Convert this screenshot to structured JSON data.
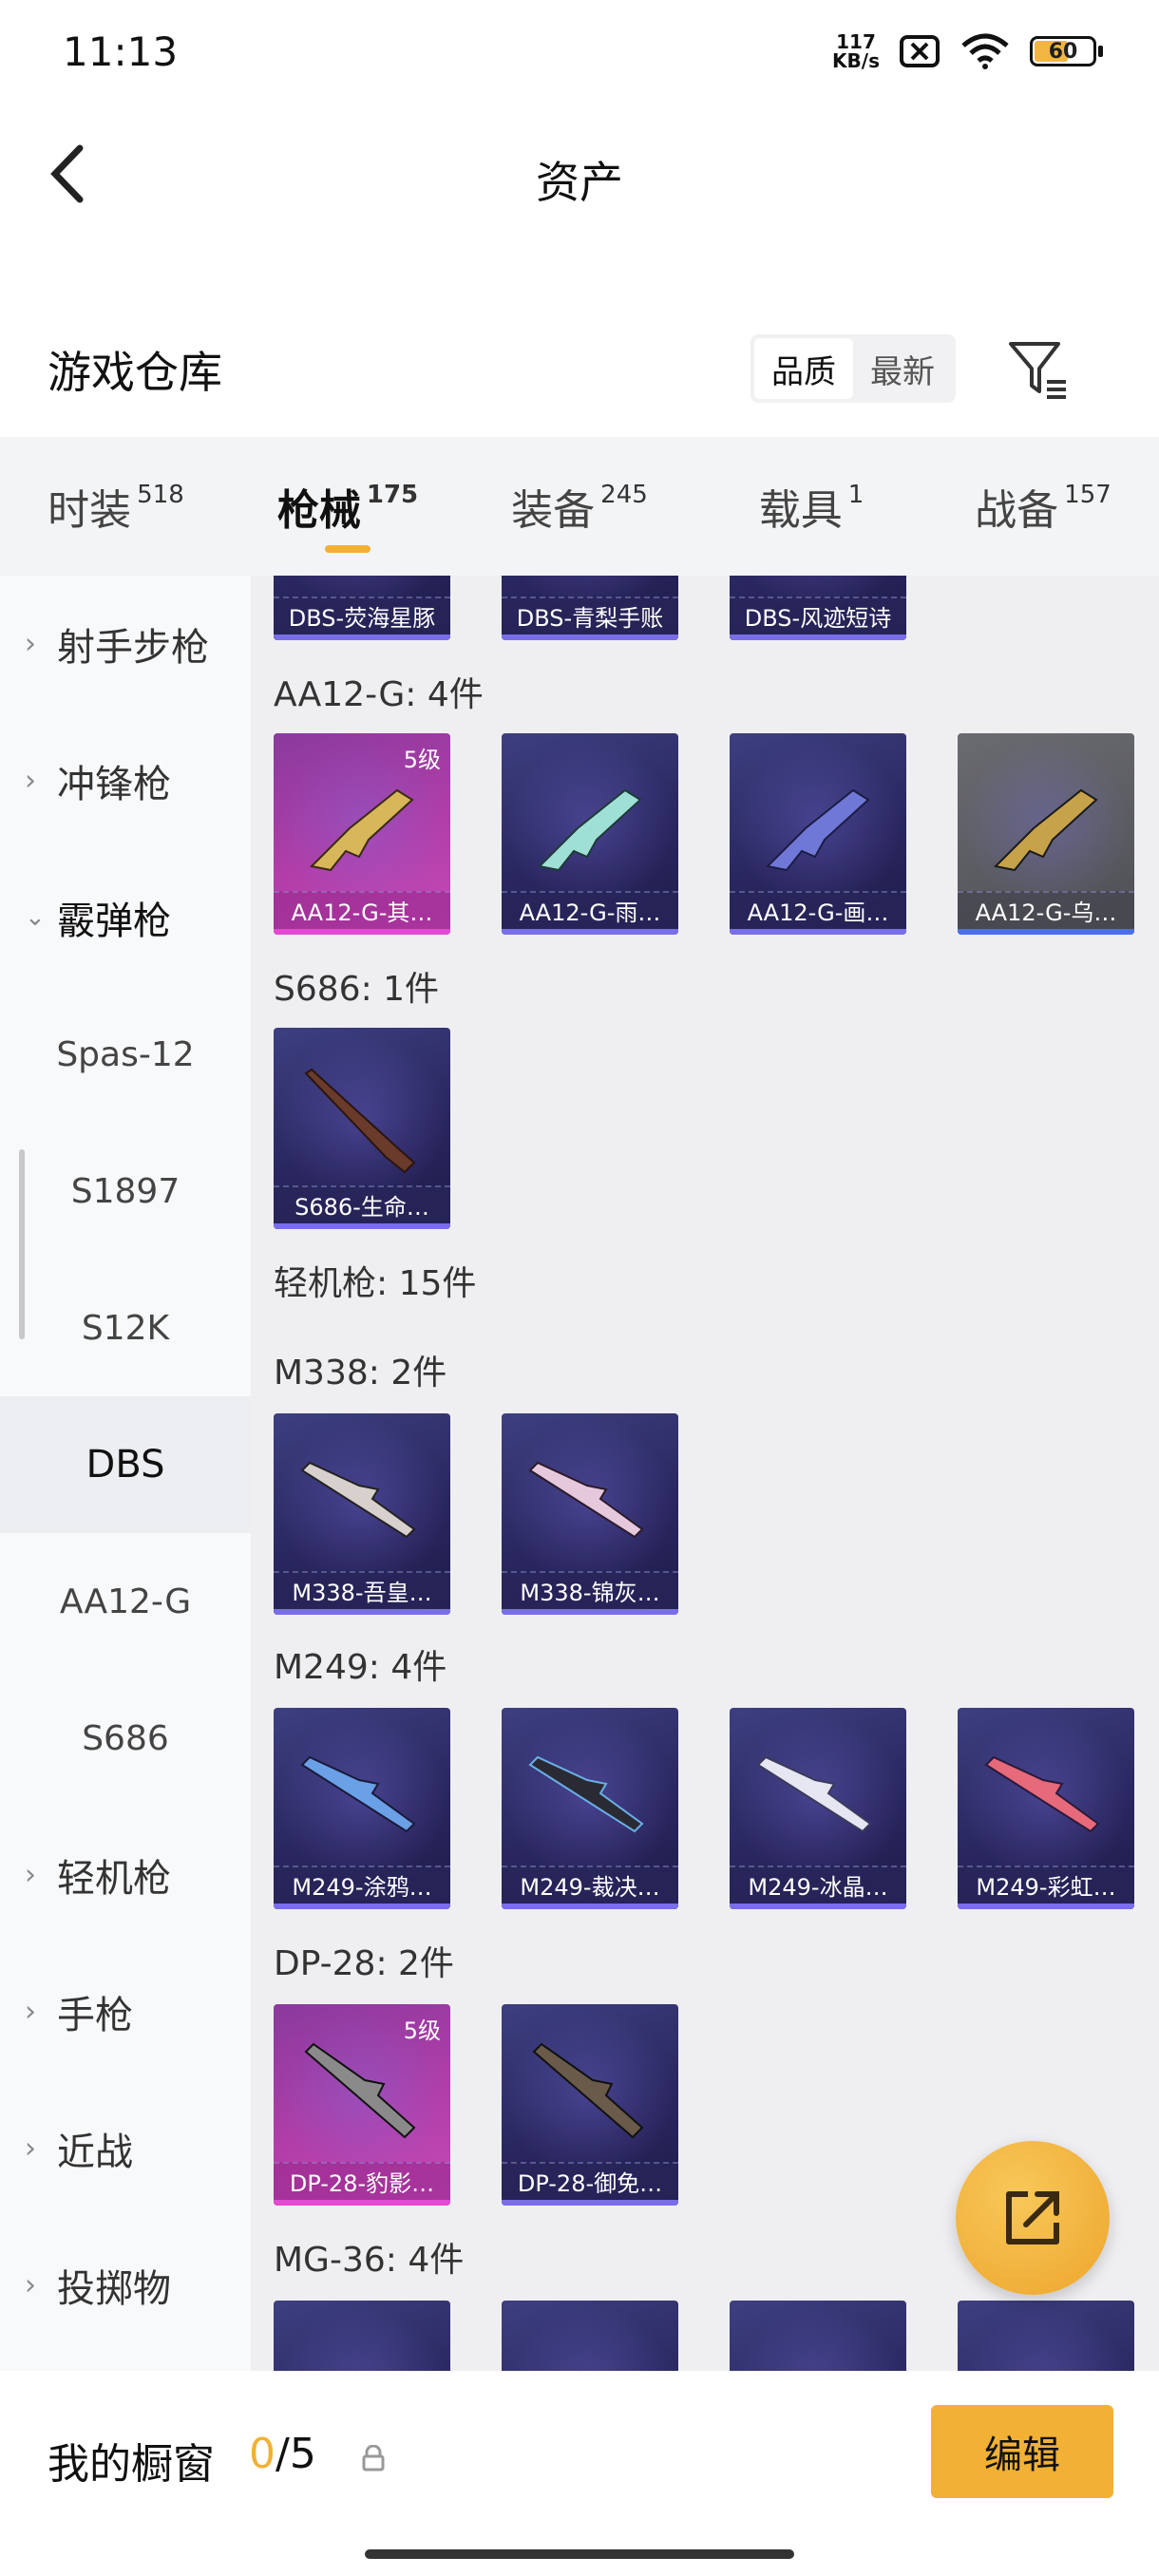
{
  "status": {
    "time": "11:13",
    "speed_value": "117",
    "speed_unit": "KB/s",
    "battery": "60"
  },
  "header": {
    "title": "资产"
  },
  "warehouse": {
    "title": "游戏仓库",
    "sort_quality": "品质",
    "sort_newest": "最新"
  },
  "tabs": [
    {
      "label": "时装",
      "count": "518"
    },
    {
      "label": "枪械",
      "count": "175"
    },
    {
      "label": "装备",
      "count": "245"
    },
    {
      "label": "载具",
      "count": "1"
    },
    {
      "label": "战备",
      "count": "157"
    }
  ],
  "sidebar": {
    "items": [
      {
        "label": "射手步枪"
      },
      {
        "label": "冲锋枪"
      },
      {
        "label": "霰弹枪"
      },
      {
        "label": "Spas-12"
      },
      {
        "label": "S1897"
      },
      {
        "label": "S12K"
      },
      {
        "label": "DBS"
      },
      {
        "label": "AA12-G"
      },
      {
        "label": "S686"
      },
      {
        "label": "轻机枪"
      },
      {
        "label": "手枪"
      },
      {
        "label": "近战"
      },
      {
        "label": "投掷物"
      }
    ]
  },
  "content": {
    "top_cards": [
      "DBS-荧海星豚",
      "DBS-青梨手账",
      "DBS-风迹短诗"
    ],
    "groups": [
      {
        "title": "AA12-G: 4件",
        "items": [
          "AA12-G-其…",
          "AA12-G-雨…",
          "AA12-G-画…",
          "AA12-G-乌…"
        ],
        "level": "5级"
      },
      {
        "title": "S686: 1件",
        "items": [
          "S686-生命…"
        ]
      },
      {
        "title": "轻机枪: 15件"
      },
      {
        "title": "M338: 2件",
        "items": [
          "M338-吾皇…",
          "M338-锦灰…"
        ]
      },
      {
        "title": "M249: 4件",
        "items": [
          "M249-涂鸦…",
          "M249-裁决…",
          "M249-冰晶…",
          "M249-彩虹…"
        ]
      },
      {
        "title": "DP-28: 2件",
        "items": [
          "DP-28-豹影…",
          "DP-28-御免…"
        ],
        "level": "5级"
      },
      {
        "title": "MG-36: 4件"
      }
    ]
  },
  "bottom": {
    "window_label": "我的橱窗",
    "count_current": "0",
    "count_total": "/5",
    "edit_label": "编辑"
  },
  "colors": {
    "accent": "#f2b135",
    "card_purple": "#2a2760",
    "card_pink": "#b23da8"
  }
}
